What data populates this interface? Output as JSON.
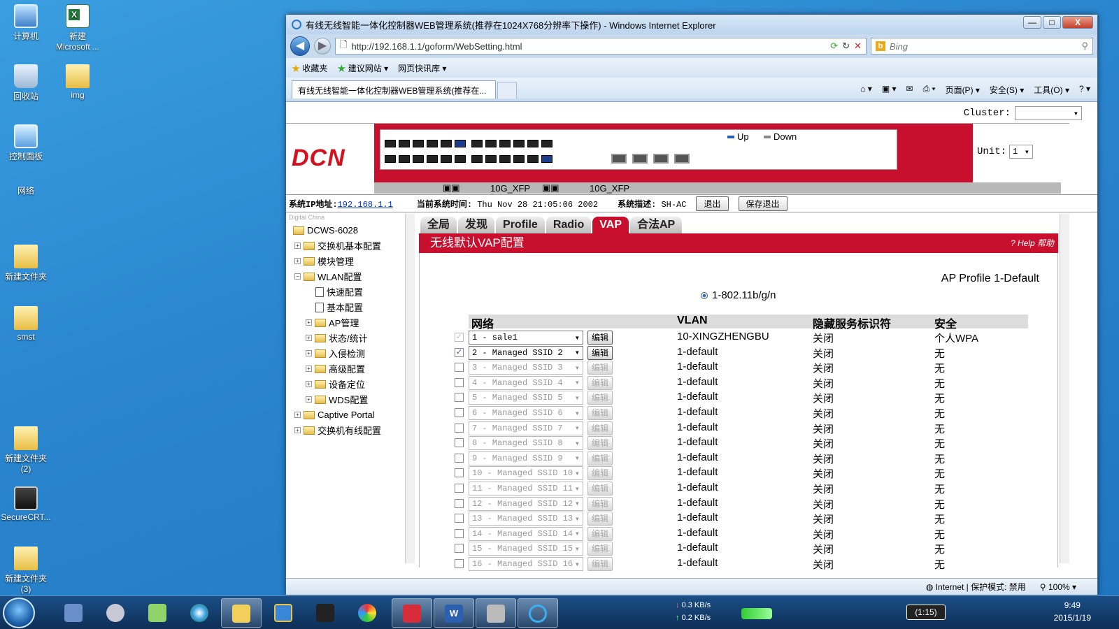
{
  "desktop": {
    "icons": [
      {
        "label": "计算机"
      },
      {
        "label": "新建\nMicrosoft ..."
      },
      {
        "label": "回收站"
      },
      {
        "label": "img"
      },
      {
        "label": "控制面板"
      },
      {
        "label": "网络"
      },
      {
        "label": "新建文件夹"
      },
      {
        "label": "smst"
      },
      {
        "label": "新建文件夹\n(2)"
      },
      {
        "label": "SecureCRT..."
      },
      {
        "label": "新建文件夹\n(3)"
      }
    ]
  },
  "browser": {
    "title": "有线无线智能一体化控制器WEB管理系统(推荐在1024X768分辨率下操作) - Windows Internet Explorer",
    "window_buttons": {
      "minimize": "—",
      "maximize": "□",
      "close": "X"
    },
    "url": "http://192.168.1.1/goform/WebSetting.html",
    "search_placeholder": "Bing",
    "favorites": {
      "label": "收藏夹",
      "suggested": "建议网站 ▾",
      "slices": "网页快讯库 ▾"
    },
    "tab_title": "有线无线智能一体化控制器WEB管理系统(推荐在...",
    "commands": {
      "page": "页面(P) ▾",
      "safety": "安全(S) ▾",
      "tools": "工具(O) ▾",
      "help": "? ▾"
    },
    "status": {
      "zone": "Internet | 保护模式: 禁用",
      "zoom": "100%"
    }
  },
  "page": {
    "cluster_label": "Cluster:",
    "cluster_value": "",
    "logo": "DCN",
    "legend_up": "Up",
    "legend_down": "Down",
    "xfp_label_1": "10G_XFP",
    "xfp_label_2": "10G_XFP",
    "unit_label": "Unit:",
    "unit_value": "1",
    "sys_ip_label": "系统IP地址:",
    "sys_ip": "192.168.1.1",
    "time_label": "当前系统时间:",
    "time_value": "Thu Nov 28 21:05:06 2002",
    "desc_label": "系统描述:",
    "desc_value": "SH-AC",
    "logout_btn": "退出",
    "save_logout_btn": "保存退出",
    "tree_caption": "Digital China",
    "tree": [
      {
        "label": "DCWS-6028"
      },
      {
        "label": "交换机基本配置"
      },
      {
        "label": "模块管理"
      },
      {
        "label": "WLAN配置"
      },
      {
        "label": "快速配置"
      },
      {
        "label": "基本配置"
      },
      {
        "label": "AP管理"
      },
      {
        "label": "状态/统计"
      },
      {
        "label": "入侵检测"
      },
      {
        "label": "高级配置"
      },
      {
        "label": "设备定位"
      },
      {
        "label": "WDS配置"
      },
      {
        "label": "Captive Portal"
      },
      {
        "label": "交换机有线配置"
      }
    ],
    "tabs": [
      "全局",
      "发现",
      "Profile",
      "Radio",
      "VAP",
      "合法AP"
    ],
    "active_tab": "VAP",
    "section_title": "无线默认VAP配置",
    "help": "? Help 帮助",
    "profile_title": "AP Profile 1-Default",
    "radio_label": "1-802.11b/g/n",
    "table_headers": {
      "network": "网络",
      "vlan": "VLAN",
      "hidden_ssid": "隐藏服务标识符",
      "security": "安全"
    },
    "edit_label": "编辑",
    "rows": [
      {
        "network": "1 - sale1",
        "vlan": "10-XINGZHENGBU",
        "hidden": "关闭",
        "security": "个人WPA",
        "checked": "✓"
      },
      {
        "network": "2 - Managed SSID 2",
        "vlan": "1-default",
        "hidden": "关闭",
        "security": "无",
        "checked": "✓"
      },
      {
        "network": "3 - Managed SSID 3",
        "vlan": "1-default",
        "hidden": "关闭",
        "security": "无",
        "checked": ""
      },
      {
        "network": "4 - Managed SSID 4",
        "vlan": "1-default",
        "hidden": "关闭",
        "security": "无",
        "checked": ""
      },
      {
        "network": "5 - Managed SSID 5",
        "vlan": "1-default",
        "hidden": "关闭",
        "security": "无",
        "checked": ""
      },
      {
        "network": "6 - Managed SSID 6",
        "vlan": "1-default",
        "hidden": "关闭",
        "security": "无",
        "checked": ""
      },
      {
        "network": "7 - Managed SSID 7",
        "vlan": "1-default",
        "hidden": "关闭",
        "security": "无",
        "checked": ""
      },
      {
        "network": "8 - Managed SSID 8",
        "vlan": "1-default",
        "hidden": "关闭",
        "security": "无",
        "checked": ""
      },
      {
        "network": "9 - Managed SSID 9",
        "vlan": "1-default",
        "hidden": "关闭",
        "security": "无",
        "checked": ""
      },
      {
        "network": "10 - Managed SSID 10",
        "vlan": "1-default",
        "hidden": "关闭",
        "security": "无",
        "checked": ""
      },
      {
        "network": "11 - Managed SSID 11",
        "vlan": "1-default",
        "hidden": "关闭",
        "security": "无",
        "checked": ""
      },
      {
        "network": "12 - Managed SSID 12",
        "vlan": "1-default",
        "hidden": "关闭",
        "security": "无",
        "checked": ""
      },
      {
        "network": "13 - Managed SSID 13",
        "vlan": "1-default",
        "hidden": "关闭",
        "security": "无",
        "checked": ""
      },
      {
        "network": "14 - Managed SSID 14",
        "vlan": "1-default",
        "hidden": "关闭",
        "security": "无",
        "checked": ""
      },
      {
        "network": "15 - Managed SSID 15",
        "vlan": "1-default",
        "hidden": "关闭",
        "security": "无",
        "checked": ""
      },
      {
        "network": "16 - Managed SSID 16",
        "vlan": "1-default",
        "hidden": "关闭",
        "security": "无",
        "checked": ""
      }
    ]
  },
  "taskbar": {
    "net_down": "0.3 KB/s",
    "net_up": "0.2 KB/s",
    "battery": "(1:15)",
    "time": "9:49",
    "date": "2015/1/19"
  }
}
